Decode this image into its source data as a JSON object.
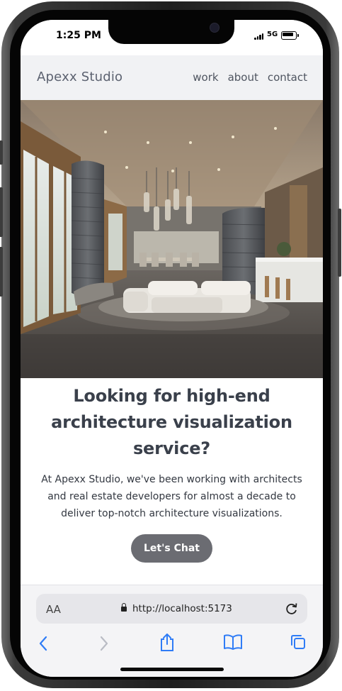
{
  "status_bar": {
    "time": "1:25 PM",
    "network": "5G"
  },
  "site": {
    "brand": "Apexx Studio",
    "nav": [
      "work",
      "about",
      "contact"
    ],
    "headline": "Looking for high-end architecture visualization service?",
    "paragraph": "At Apexx Studio, we've been working with architects and real estate developers for almost a decade to deliver top-notch architecture visualizations.",
    "cta_label": "Let's Chat"
  },
  "browser": {
    "text_size_label": "AA",
    "url": "http://localhost:5173",
    "toolbar_icons": [
      "back-icon",
      "forward-icon",
      "share-icon",
      "bookmarks-icon",
      "tabs-icon"
    ]
  },
  "colors": {
    "header_bg": "#f1f2f4",
    "headline": "#3a404b",
    "cta_bg": "#6b6c72",
    "safari_accent": "#2f7cf6"
  }
}
